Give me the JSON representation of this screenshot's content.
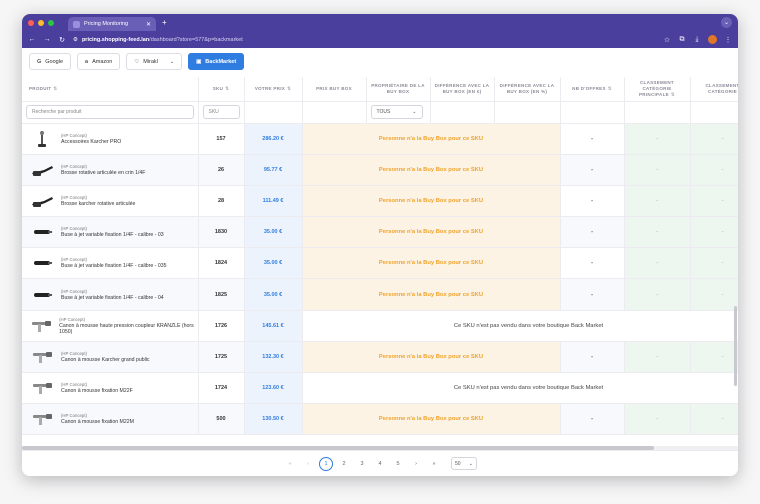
{
  "browser": {
    "tab_title": "Pricing Monitoring",
    "url_host": "pricing.shopping-feed.lan",
    "url_path": "/dashboard?store=577&p=backmarket"
  },
  "channels": [
    {
      "label": "Google",
      "icon": "google-icon",
      "active": false
    },
    {
      "label": "Amazon",
      "icon": "amazon-icon",
      "active": false
    },
    {
      "label": "Mirakl",
      "icon": "mirakl-icon",
      "active": false
    },
    {
      "label": "BackMarket",
      "icon": "backmarket-icon",
      "active": true
    }
  ],
  "columns": {
    "produit": "PRODUIT",
    "sku": "SKU",
    "votre_prix": "VOTRE PRIX",
    "prix_buybox": "PRIX BUY BOX",
    "proprietaire": "PROPRIÉTAIRE DE LA BUY BOX",
    "diff_eur": "DIFFÉRENCE AVEC LA BUY BOX (EN €)",
    "diff_pct": "DIFFÉRENCE AVEC LA BUY BOX (EN %)",
    "nb_offres": "NB D'OFFRES",
    "class_principale": "CLASSEMENT CATÉGORIE PRINCIPALE",
    "class_categorie": "CLASSEMENT CATÉGORIE"
  },
  "filters": {
    "product_placeholder": "Recherche par produit",
    "sku_placeholder": "SKU",
    "owner_value": "TOUS"
  },
  "messages": {
    "no_buybox": "Personne n'a la Buy Box pour ce SKU",
    "not_sold": "Ce SKU n'est pas vendu dans votre boutique Back Market"
  },
  "rows": [
    {
      "brand": "(HP Concept)",
      "name": "Accessoires Karcher PRO",
      "sku": "157",
      "price": "286.20 €",
      "status": "nobox",
      "img": "attachment"
    },
    {
      "brand": "(HP Concept)",
      "name": "Brosse rotative articulée en crin 1/4F",
      "sku": "26",
      "price": "95.77 €",
      "status": "nobox",
      "img": "brush"
    },
    {
      "brand": "(HP Concept)",
      "name": "Brosse karcher rotative articulée",
      "sku": "28",
      "price": "111.49 €",
      "status": "nobox",
      "img": "brush"
    },
    {
      "brand": "(HP Concept)",
      "name": "Buse à jet variable fixation 1/4F - calibre - 03",
      "sku": "1830",
      "price": "35.00 €",
      "status": "nobox",
      "img": "nozzle"
    },
    {
      "brand": "(HP Concept)",
      "name": "Buse à jet variable fixation 1/4F - calibre - 035",
      "sku": "1824",
      "price": "35.00 €",
      "status": "nobox",
      "img": "nozzle"
    },
    {
      "brand": "(HP Concept)",
      "name": "Buse à jet variable fixation 1/4F - calibre - 04",
      "sku": "1825",
      "price": "35.00 €",
      "status": "nobox",
      "img": "nozzle"
    },
    {
      "brand": "(HP Concept)",
      "name": "Canon à mousse haute pression coupleur KRANZLE (hors 1050)",
      "sku": "1726",
      "price": "145.61 €",
      "status": "notsold",
      "img": "cannon"
    },
    {
      "brand": "(HP Concept)",
      "name": "Canon à mousse Karcher grand public",
      "sku": "1725",
      "price": "132.30 €",
      "status": "nobox",
      "img": "cannon"
    },
    {
      "brand": "(HP Concept)",
      "name": "Canon à mousse fixation M22F",
      "sku": "1724",
      "price": "123.60 €",
      "status": "notsold",
      "img": "cannon"
    },
    {
      "brand": "(HP Concept)",
      "name": "Canon à mousse fixation M22M",
      "sku": "500",
      "price": "130.50 €",
      "status": "nobox",
      "img": "cannon"
    }
  ],
  "cell_dash": "-",
  "pagination": {
    "first": "«",
    "prev": "‹",
    "pages": [
      "1",
      "2",
      "3",
      "4",
      "5"
    ],
    "current": "1",
    "next": "›",
    "last": "»",
    "per_page": "50"
  }
}
